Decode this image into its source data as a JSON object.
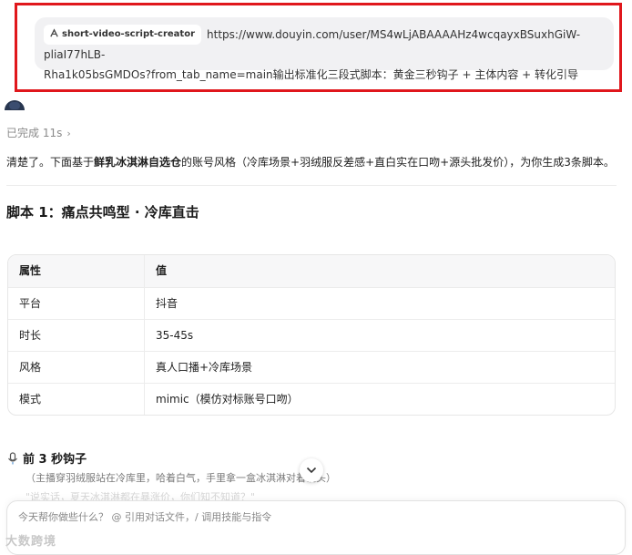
{
  "user_prompt": {
    "skill_chip": "short-video-script-creator",
    "line1": "https://www.douyin.com/user/MS4wLjABAAAAHz4wcqayxBSuxhGiW-pliaI77hLB-",
    "line2": "Rha1k05bsGMDOs?from_tab_name=main输出标准化三段式脚本：黄金三秒钩子 + 主体内容 + 转化引导"
  },
  "status": {
    "done_label": "已完成 11s",
    "chevron": "›"
  },
  "intro": {
    "prefix": "清楚了。下面基于",
    "brand": "鲜乳冰淇淋自选仓",
    "suffix": "的账号风格（冷库场景+羽绒服反差感+直白实在口吻+源头批发价），为你生成3条脚本。"
  },
  "script1": {
    "title": "脚本 1：痛点共鸣型 · 冷库直击",
    "table": {
      "headers": [
        "属性",
        "值"
      ],
      "rows": [
        [
          "平台",
          "抖音"
        ],
        [
          "时长",
          "35-45s"
        ],
        [
          "风格",
          "真人口播+冷库场景"
        ],
        [
          "模式",
          "mimic（模仿对标账号口吻）"
        ]
      ]
    },
    "hook": {
      "title": "前 3 秒钩子",
      "direction": "（主播穿羽绒服站在冷库里，哈着白气，手里拿一盒冰淇淋对着镜头）",
      "line_faded": "\"说实话，夏天冰淇淋都在暴涨价，你们知不知道？\""
    }
  },
  "composer": {
    "placeholder": "今天帮你做些什么？ @ 引用对话文件，/ 调用技能与指令"
  },
  "watermark": "大数跨境"
}
